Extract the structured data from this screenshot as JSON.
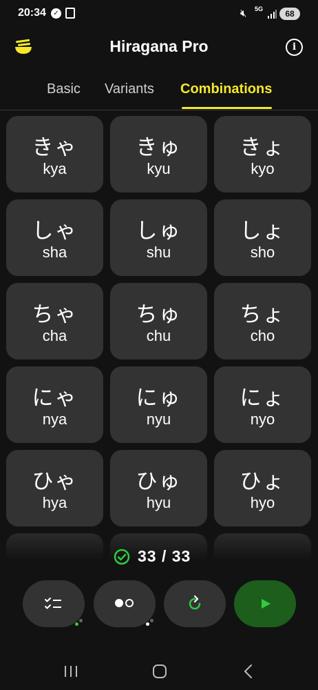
{
  "status_bar": {
    "time": "20:34",
    "network": "5G",
    "battery": "68"
  },
  "app": {
    "title": "Hiragana Pro",
    "logo_icon": "noodle-bowl-icon",
    "accent": "#f5e92a"
  },
  "tabs": [
    {
      "label": "Basic",
      "selected": false
    },
    {
      "label": "Variants",
      "selected": false
    },
    {
      "label": "Combinations",
      "selected": true
    }
  ],
  "grid": {
    "cells": [
      {
        "kana": "きゃ",
        "romaji": "kya"
      },
      {
        "kana": "きゅ",
        "romaji": "kyu"
      },
      {
        "kana": "きょ",
        "romaji": "kyo"
      },
      {
        "kana": "しゃ",
        "romaji": "sha"
      },
      {
        "kana": "しゅ",
        "romaji": "shu"
      },
      {
        "kana": "しょ",
        "romaji": "sho"
      },
      {
        "kana": "ちゃ",
        "romaji": "cha"
      },
      {
        "kana": "ちゅ",
        "romaji": "chu"
      },
      {
        "kana": "ちょ",
        "romaji": "cho"
      },
      {
        "kana": "にゃ",
        "romaji": "nya"
      },
      {
        "kana": "にゅ",
        "romaji": "nyu"
      },
      {
        "kana": "にょ",
        "romaji": "nyo"
      },
      {
        "kana": "ひゃ",
        "romaji": "hya"
      },
      {
        "kana": "ひゅ",
        "romaji": "hyu"
      },
      {
        "kana": "ひょ",
        "romaji": "hyo"
      },
      {
        "kana": "",
        "romaji": ""
      },
      {
        "kana": "",
        "romaji": ""
      },
      {
        "kana": "",
        "romaji": ""
      }
    ]
  },
  "progress": {
    "text": "33 / 33",
    "color": "#2ecc40"
  },
  "controls": [
    {
      "icon": "checklist-icon"
    },
    {
      "icon": "toggle-dots-icon"
    },
    {
      "icon": "refresh-icon"
    },
    {
      "icon": "play-icon",
      "color": "#1d5e1d"
    }
  ]
}
